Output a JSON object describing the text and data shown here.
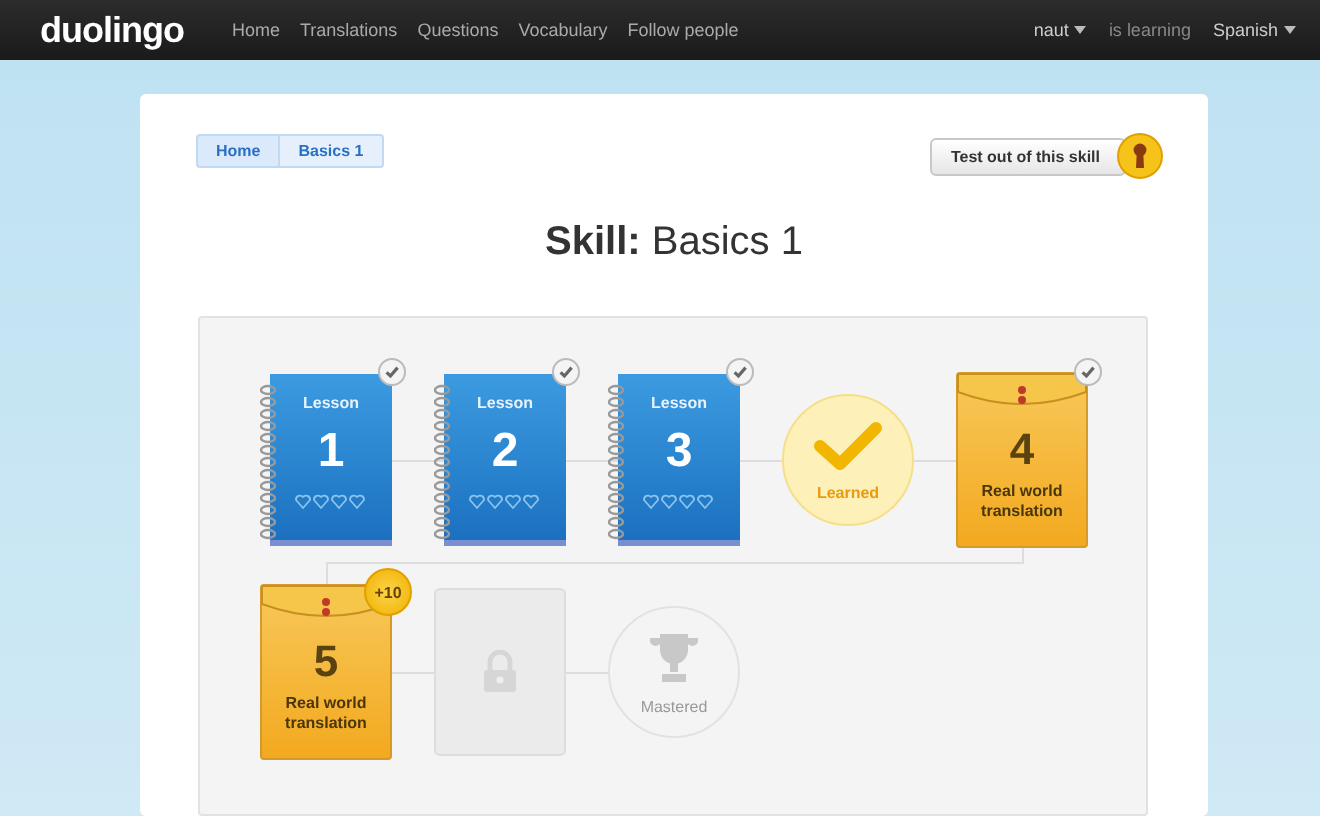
{
  "navbar": {
    "logo": "duolingo",
    "links": [
      "Home",
      "Translations",
      "Questions",
      "Vocabulary",
      "Follow people"
    ],
    "user": "naut",
    "status": "is learning",
    "language": "Spanish"
  },
  "breadcrumb": [
    {
      "label": "Home",
      "selected": false
    },
    {
      "label": "Basics 1",
      "selected": true
    }
  ],
  "test_out_button": {
    "label": "Test out of this skill"
  },
  "title": {
    "prefix": "Skill:",
    "name": "Basics 1"
  },
  "rows": [
    [
      {
        "kind": "lesson",
        "label": "Lesson",
        "number": "1",
        "completed": true
      },
      {
        "kind": "lesson",
        "label": "Lesson",
        "number": "2",
        "completed": true
      },
      {
        "kind": "lesson",
        "label": "Lesson",
        "number": "3",
        "completed": true
      },
      {
        "kind": "milestone",
        "label": "Learned",
        "achieved": true
      },
      {
        "kind": "translation",
        "number": "4",
        "label": "Real world translation",
        "completed": true
      }
    ],
    [
      {
        "kind": "translation",
        "number": "5",
        "label": "Real world translation",
        "completed": false,
        "badge": "+10"
      },
      {
        "kind": "locked"
      },
      {
        "kind": "milestone",
        "label": "Mastered",
        "achieved": false
      }
    ]
  ]
}
